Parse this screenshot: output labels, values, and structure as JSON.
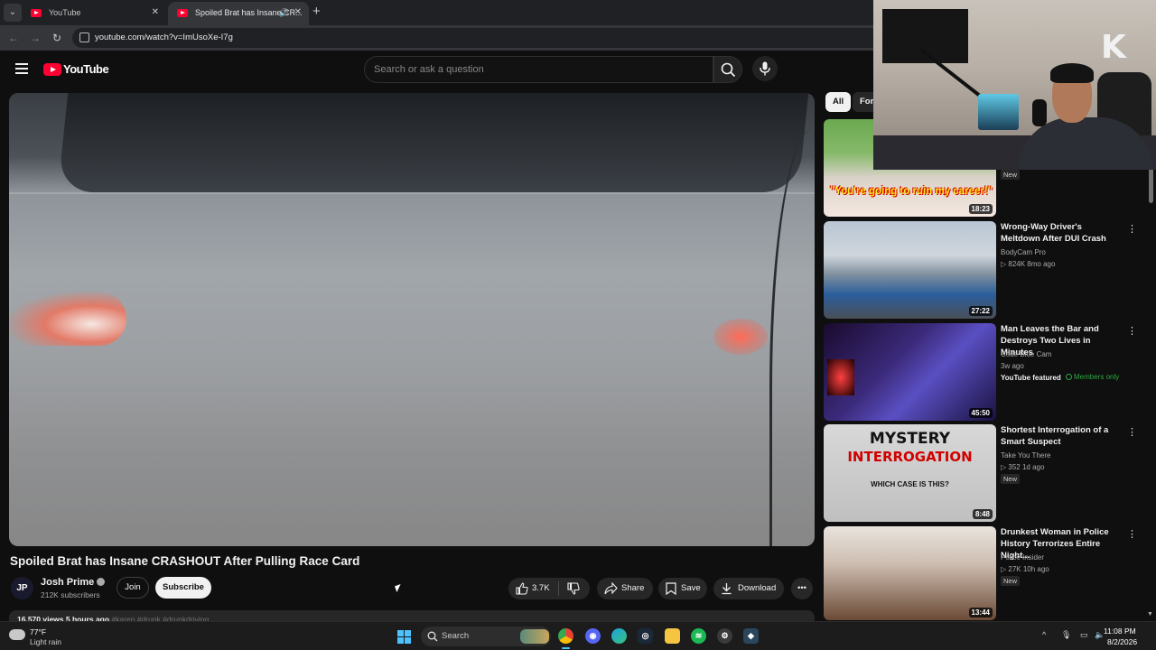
{
  "browser": {
    "tabs": [
      {
        "label": "YouTube"
      },
      {
        "label": "Spoiled Brat has Insane CR..."
      }
    ],
    "new_tab": "+",
    "url": "youtube.com/watch?v=ImUsoXe-I7g"
  },
  "header": {
    "logo_text": "YouTube",
    "search_placeholder": "Search or ask a question"
  },
  "video": {
    "title": "Spoiled Brat has Insane CRASHOUT After Pulling Race Card",
    "channel": {
      "name": "Josh Prime",
      "subscribers": "212K subscribers",
      "avatar_text": "JP"
    },
    "join_label": "Join",
    "subscribe_label": "Subscribe",
    "likes": "3.7K",
    "share_label": "Share",
    "save_label": "Save",
    "download_label": "Download",
    "description_line": "16,570 views  5 hours ago",
    "hashtags": "#karen #drunk #drunkdriving"
  },
  "sidebar": {
    "chips": [
      {
        "label": "All"
      },
      {
        "label": "For"
      }
    ],
    "recommendations": [
      {
        "title": "",
        "channel": "",
        "meta": "",
        "duration": "18:23",
        "badge": "New",
        "thumb_text": "\"You're going to ruin my career!\""
      },
      {
        "title": "Wrong-Way Driver's Meltdown After DUI Crash",
        "channel": "BodyCam Pro",
        "meta": "▷ 824K  8mo ago",
        "duration": "27:22"
      },
      {
        "title": "Man Leaves the Bar and Destroys Two Lives in Minutes",
        "channel": "Code Blue Cam",
        "meta": "3w ago",
        "duration": "45:50",
        "featured": "YouTube featured",
        "members": "Members only"
      },
      {
        "title": "Shortest Interrogation of a Smart Suspect",
        "channel": "Take You There",
        "meta": "▷ 352  1d ago",
        "duration": "8:48",
        "badge": "New",
        "thumb_line1": "MYSTERY",
        "thumb_line2": "INTERROGATION",
        "thumb_line3": "WHICH CASE IS THIS?"
      },
      {
        "title": "Drunkest Woman in Police History Terrorizes Entire Night...",
        "channel": "Police Insider",
        "meta": "▷ 27K  10h ago",
        "duration": "13:44",
        "badge": "New"
      }
    ]
  },
  "taskbar": {
    "weather_temp": "77°F",
    "weather_desc": "Light rain",
    "search_label": "Search",
    "time": "11:08 PM",
    "date": "8/2/2026"
  },
  "colors": {
    "accent": "#ff0033",
    "background": "#0f0f0f",
    "members_green": "#2ba640"
  },
  "icons": [
    "search-icon",
    "mic-icon",
    "like-icon",
    "dislike-icon",
    "share-icon",
    "save-icon",
    "download-icon",
    "more-icon",
    "windows-start-icon",
    "chrome-icon",
    "discord-icon",
    "edge-icon",
    "steam-icon",
    "explorer-icon",
    "spotify-icon"
  ]
}
